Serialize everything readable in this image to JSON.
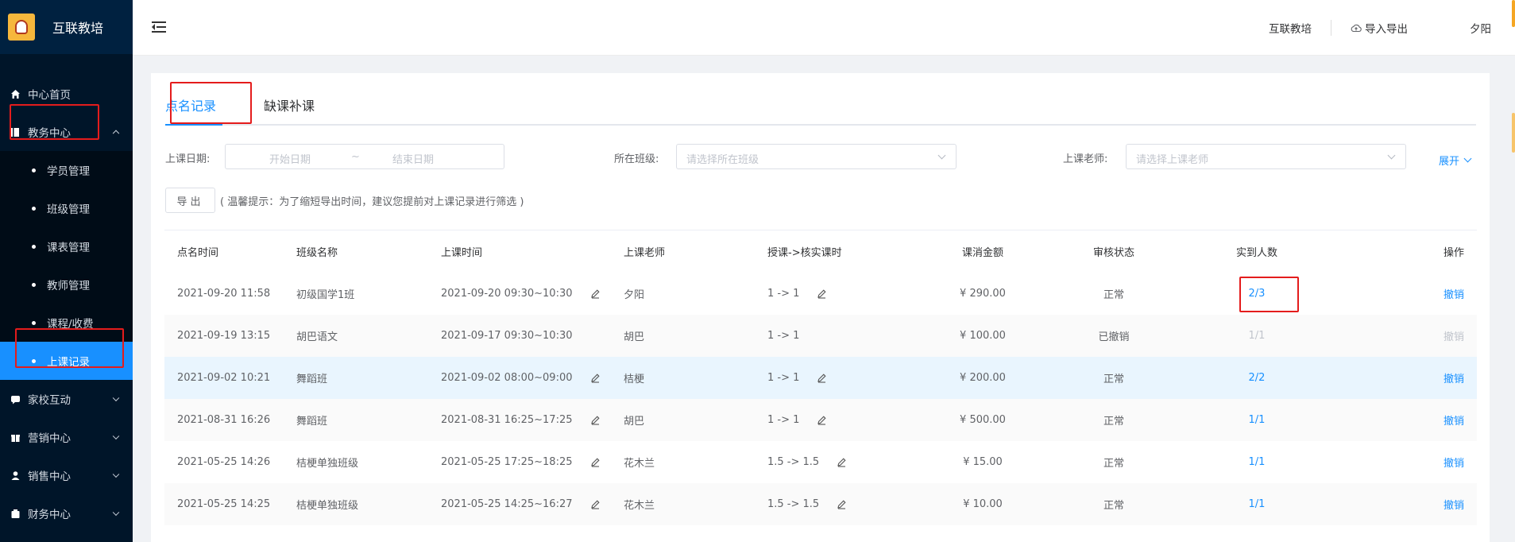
{
  "app": {
    "title": "互联教培",
    "logo_text": "互联教培"
  },
  "sidebar": {
    "items": [
      {
        "label": "中心首页",
        "icon": "home-icon"
      },
      {
        "label": "教务中心",
        "icon": "book-icon",
        "expanded": true
      },
      {
        "label": "家校互动",
        "icon": "chat-icon"
      },
      {
        "label": "营销中心",
        "icon": "gift-icon"
      },
      {
        "label": "销售中心",
        "icon": "user-icon"
      },
      {
        "label": "财务中心",
        "icon": "wallet-icon"
      }
    ],
    "sub_items": [
      "学员管理",
      "班级管理",
      "课表管理",
      "教师管理",
      "课程/收费",
      "上课记录"
    ],
    "active_sub": "上课记录"
  },
  "header": {
    "org": "互联教培",
    "import_export": "导入导出",
    "user": "夕阳"
  },
  "tabs": {
    "active": "点名记录",
    "other": "缺课补课"
  },
  "filters": {
    "date_label": "上课日期:",
    "date_start_placeholder": "开始日期",
    "date_sep": "~",
    "date_end_placeholder": "结束日期",
    "class_label": "所在班级:",
    "class_placeholder": "请选择所在班级",
    "teacher_label": "上课老师:",
    "teacher_placeholder": "请选择上课老师",
    "expand": "展开"
  },
  "toolbar": {
    "export_label": "导出",
    "hint": "( 温馨提示：为了缩短导出时间，建议您提前对上课记录进行筛选 )"
  },
  "table": {
    "columns": [
      "点名时间",
      "班级名称",
      "上课时间",
      "上课老师",
      "授课->核实课时",
      "课消金额",
      "审核状态",
      "实到人数",
      "操作"
    ],
    "rows": [
      {
        "roll_time": "2021-09-20 11:58",
        "class_name": "初级国学1班",
        "class_time": "2021-09-20 09:30~10:30",
        "teacher": "夕阳",
        "hours": "1 -> 1",
        "amount": "¥ 290.00",
        "status": "正常",
        "attendance": "2/3",
        "action": "撤销",
        "editable": true,
        "cancelled": false
      },
      {
        "roll_time": "2021-09-19 13:15",
        "class_name": "胡巴语文",
        "class_time": "2021-09-17 09:30~10:30",
        "teacher": "胡巴",
        "hours": "1 -> 1",
        "amount": "¥ 100.00",
        "status": "已撤销",
        "attendance": "1/1",
        "action": "撤销",
        "editable": false,
        "cancelled": true
      },
      {
        "roll_time": "2021-09-02 10:21",
        "class_name": "舞蹈班",
        "class_time": "2021-09-02 08:00~09:00",
        "teacher": "桔梗",
        "hours": "1 -> 1",
        "amount": "¥ 200.00",
        "status": "正常",
        "attendance": "2/2",
        "action": "撤销",
        "editable": true,
        "cancelled": false
      },
      {
        "roll_time": "2021-08-31 16:26",
        "class_name": "舞蹈班",
        "class_time": "2021-08-31 16:25~17:25",
        "teacher": "胡巴",
        "hours": "1 -> 1",
        "amount": "¥ 500.00",
        "status": "正常",
        "attendance": "1/1",
        "action": "撤销",
        "editable": true,
        "cancelled": false
      },
      {
        "roll_time": "2021-05-25 14:26",
        "class_name": "桔梗单独班级",
        "class_time": "2021-05-25 17:25~18:25",
        "teacher": "花木兰",
        "hours": "1.5 -> 1.5",
        "amount": "¥ 15.00",
        "status": "正常",
        "attendance": "1/1",
        "action": "撤销",
        "editable": true,
        "cancelled": false
      },
      {
        "roll_time": "2021-05-25 14:25",
        "class_name": "桔梗单独班级",
        "class_time": "2021-05-25 14:25~16:27",
        "teacher": "花木兰",
        "hours": "1.5 -> 1.5",
        "amount": "¥ 10.00",
        "status": "正常",
        "attendance": "1/1",
        "action": "撤销",
        "editable": true,
        "cancelled": false
      }
    ]
  },
  "colors": {
    "sidebar": "#001529",
    "accent": "#1890ff",
    "highlight_box": "#e41c1c"
  }
}
